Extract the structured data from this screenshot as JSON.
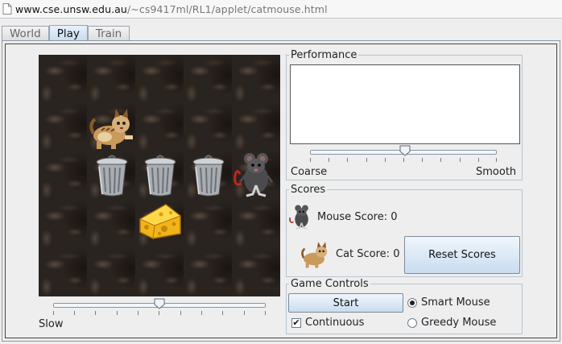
{
  "browser": {
    "url_host": "www.cse.unsw.edu.au",
    "url_path": "/~cs9417ml/RL1/applet/catmouse.html"
  },
  "tabs": [
    {
      "label": "World",
      "active": false
    },
    {
      "label": "Play",
      "active": true
    },
    {
      "label": "Train",
      "active": false
    }
  ],
  "speed": {
    "min_label": "Slow",
    "value_fraction": 0.5
  },
  "performance": {
    "title": "Performance",
    "slider_min_label": "Coarse",
    "slider_max_label": "Smooth",
    "value_fraction": 0.5
  },
  "scores": {
    "title": "Scores",
    "mouse_label": "Mouse Score:",
    "mouse_score": "0",
    "cat_label": "Cat Score:",
    "cat_score": "0",
    "reset_label": "Reset Scores"
  },
  "controls": {
    "title": "Game Controls",
    "start_label": "Start",
    "continuous_label": "Continuous",
    "continuous_checked": true,
    "smart_mouse_label": "Smart Mouse",
    "smart_mouse_selected": true,
    "greedy_mouse_label": "Greedy Mouse",
    "greedy_mouse_selected": false
  },
  "board": {
    "pieces": [
      "cat",
      "trash-can",
      "trash-can",
      "trash-can",
      "mouse",
      "cheese"
    ]
  },
  "colors": {
    "tab_active": "#c6dcf0",
    "button": "#d6e5f4",
    "board_bg": "#2a2420"
  }
}
